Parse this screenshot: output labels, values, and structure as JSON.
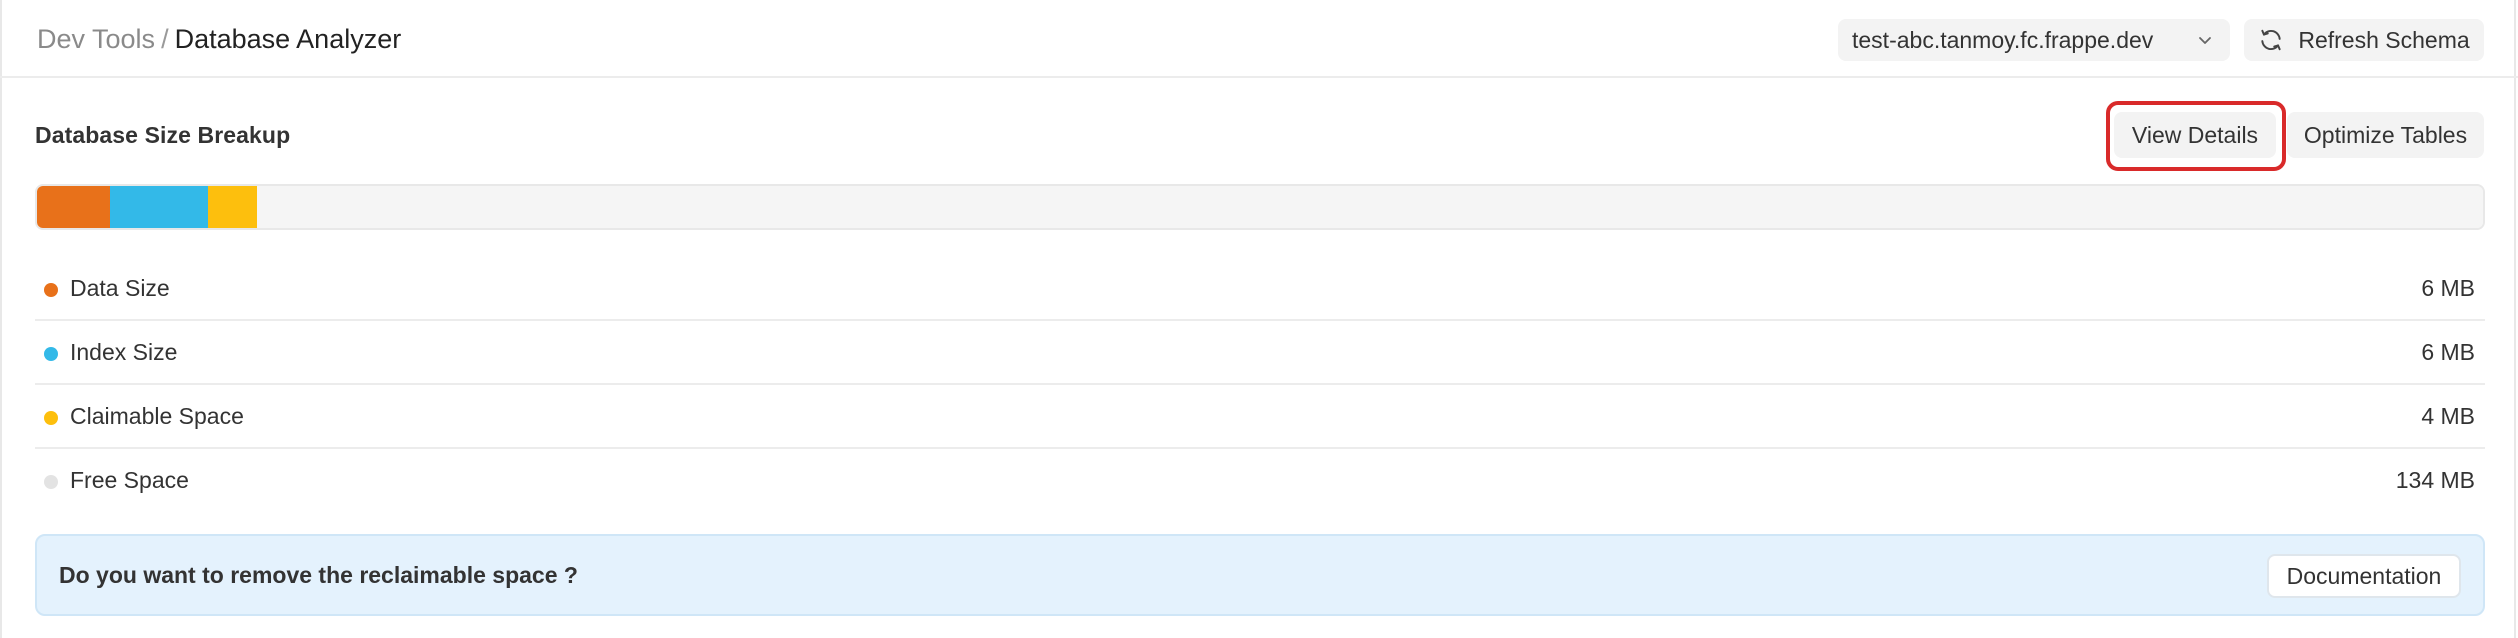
{
  "breadcrumb": {
    "parent": "Dev Tools",
    "separator": "/",
    "current": "Database Analyzer"
  },
  "site_selector": {
    "value": "test-abc.tanmoy.fc.frappe.dev",
    "icon": "chevron-down-icon"
  },
  "refresh_button": {
    "label": "Refresh Schema",
    "icon": "refresh-icon"
  },
  "section": {
    "title": "Database Size Breakup",
    "view_details_label": "View Details",
    "optimize_label": "Optimize Tables",
    "highlight_color": "#d92a2a"
  },
  "size_bar": {
    "segments": [
      {
        "name": "Data Size",
        "fraction": 0.03,
        "color": "#e8711a"
      },
      {
        "name": "Index Size",
        "fraction": 0.04,
        "color": "#33b9e8"
      },
      {
        "name": "Claimable Space",
        "fraction": 0.02,
        "color": "#fdbf0d"
      },
      {
        "name": "Free Space",
        "fraction": 0.91,
        "color": "#f5f5f5"
      }
    ]
  },
  "legend": [
    {
      "label": "Data Size",
      "value": "6 MB",
      "color": "#e8711a"
    },
    {
      "label": "Index Size",
      "value": "6 MB",
      "color": "#33b9e8"
    },
    {
      "label": "Claimable Space",
      "value": "4 MB",
      "color": "#fdbf0d"
    },
    {
      "label": "Free Space",
      "value": "134 MB",
      "color": "#e3e3e3"
    }
  ],
  "banner": {
    "text": "Do you want to remove the reclaimable space ?",
    "button_label": "Documentation"
  }
}
